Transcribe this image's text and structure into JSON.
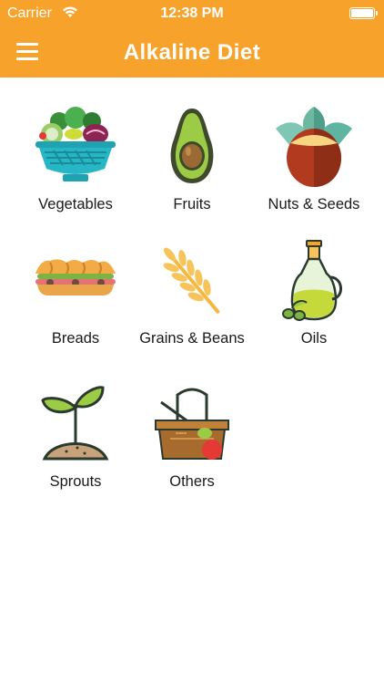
{
  "status_bar": {
    "carrier": "Carrier",
    "time": "12:38 PM"
  },
  "header": {
    "title": "Alkaline Diet",
    "background_color": "#f7a22a",
    "menu_icon": "hamburger-menu-icon"
  },
  "categories": [
    {
      "label": "Vegetables",
      "icon": "vegetable-bowl-icon"
    },
    {
      "label": "Fruits",
      "icon": "avocado-icon"
    },
    {
      "label": "Nuts & Seeds",
      "icon": "nut-icon"
    },
    {
      "label": "Breads",
      "icon": "sandwich-icon"
    },
    {
      "label": "Grains & Beans",
      "icon": "wheat-icon"
    },
    {
      "label": "Oils",
      "icon": "oil-bottle-icon"
    },
    {
      "label": "Sprouts",
      "icon": "sprout-icon"
    },
    {
      "label": "Others",
      "icon": "basket-icon"
    }
  ]
}
